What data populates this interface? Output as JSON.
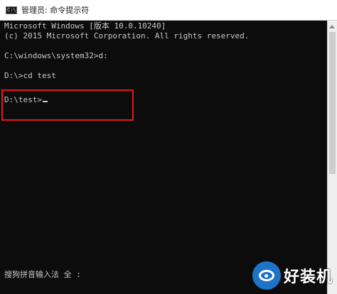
{
  "window": {
    "title": "管理员: 命令提示符",
    "icon": "cmd-icon",
    "icon_glyph": "C:\\"
  },
  "console": {
    "lines": [
      "Microsoft Windows [版本 10.0.10240]",
      "(c) 2015 Microsoft Corporation. All rights reserved.",
      "",
      "C:\\windows\\system32>d:",
      "",
      "D:\\>cd test",
      "",
      "D:\\test>"
    ]
  },
  "ime": {
    "status": "搜狗拼音输入法 全 :"
  },
  "watermark": {
    "text": "好装机",
    "icon": "eye-logo-icon"
  },
  "colors": {
    "console_bg": "#0c0c0c",
    "console_text": "#c8c8c8",
    "highlight": "#e21b1b"
  }
}
